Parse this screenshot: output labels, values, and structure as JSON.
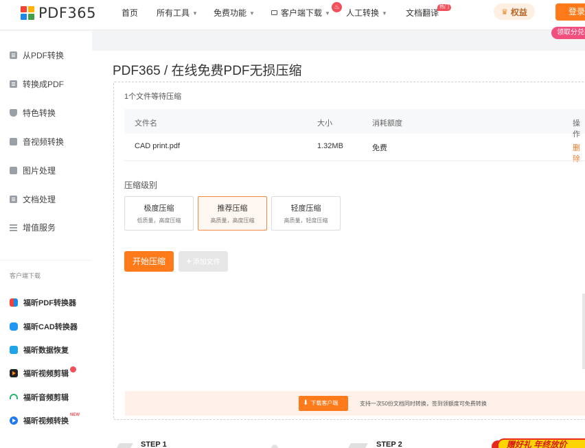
{
  "header": {
    "logo_text": "PDF365",
    "nav": [
      {
        "label": "首页"
      },
      {
        "label": "所有工具"
      },
      {
        "label": "免费功能"
      },
      {
        "label": "客户端下载"
      },
      {
        "label": "人工转换"
      },
      {
        "label": "文档翻译"
      }
    ],
    "hot_badge": "热门",
    "quanyi_label": "权益",
    "login_label": "登录",
    "gift_tag": "领取分兑礼"
  },
  "sidebar": {
    "items": [
      {
        "label": "从PDF转换",
        "icon": "pdf-from-icon"
      },
      {
        "label": "转换成PDF",
        "icon": "pdf-to-icon"
      },
      {
        "label": "特色转换",
        "icon": "shield-icon"
      },
      {
        "label": "音视频转换",
        "icon": "media-icon"
      },
      {
        "label": "图片处理",
        "icon": "image-icon"
      },
      {
        "label": "文档处理",
        "icon": "document-icon"
      },
      {
        "label": "增值服务",
        "icon": "list-icon"
      }
    ],
    "client_caption": "客户端下载",
    "clients": [
      {
        "label": "福昕PDF转换器"
      },
      {
        "label": "福昕CAD转换器"
      },
      {
        "label": "福昕数据恢复"
      },
      {
        "label": "福昕视频剪辑"
      },
      {
        "label": "福昕音频剪辑"
      },
      {
        "label": "福昕视频转换"
      }
    ],
    "new_tag": "NEW"
  },
  "main": {
    "title": "PDF365 / 在线免费PDF无损压缩",
    "waiting_text": "1个文件等待压缩",
    "table": {
      "headers": [
        "文件名",
        "大小",
        "消耗额度",
        "操作"
      ],
      "rows": [
        {
          "name": "CAD print.pdf",
          "size": "1.32MB",
          "quota": "免费",
          "action": "删除"
        }
      ]
    },
    "level_label": "压缩级别",
    "levels": [
      {
        "name": "极度压缩",
        "desc": "低质量，高度压缩",
        "active": false
      },
      {
        "name": "推荐压缩",
        "desc": "高质量，高度压缩",
        "active": true
      },
      {
        "name": "轻度压缩",
        "desc": "高质量，轻度压缩",
        "active": false
      }
    ],
    "start_label": "开始压缩",
    "add_label": "添加文件",
    "banner": {
      "download_label": "下载客户端",
      "text": "支持一次50份文档同时转换，签到领额度可免费转换"
    },
    "steps": [
      {
        "label": "STEP 1"
      },
      {
        "label": "STEP 2"
      }
    ],
    "promo_text": "赠好礼 年终放价"
  },
  "colors": {
    "accent": "#ff7a1a",
    "danger": "#f24f5a"
  }
}
